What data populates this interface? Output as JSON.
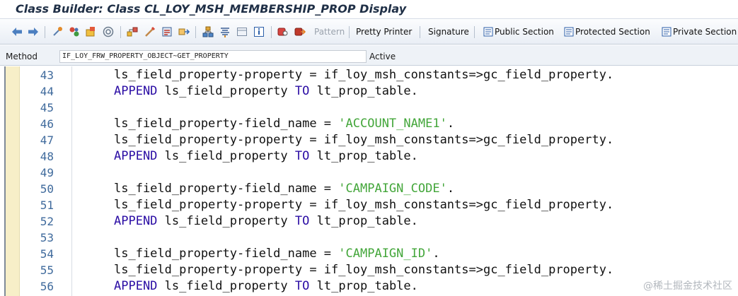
{
  "window": {
    "title": "Class Builder: Class CL_LOY_MSH_MEMBERSHIP_PROP Display"
  },
  "toolbar": {
    "icons": [
      "back-arrow-icon",
      "forward-arrow-icon",
      "other-object-icon",
      "display-change-icon",
      "active-inactive-icon",
      "activate-icon",
      "where-used-icon",
      "check-icon",
      "test-icon",
      "display-object-list-icon",
      "navigation-window-icon",
      "enhance-icon",
      "help-icon",
      "info-icon",
      "find-icon",
      "find-next-icon"
    ],
    "pattern_label": "Pattern",
    "pretty_printer_label": "Pretty Printer",
    "signature_label": "Signature",
    "public_section_label": "Public Section",
    "protected_section_label": "Protected Section",
    "private_section_label": "Private Section"
  },
  "method_bar": {
    "label": "Method",
    "value": "IF_LOY_FRW_PROPERTY_OBJECT~GET_PROPERTY",
    "status": "Active"
  },
  "editor": {
    "lines": [
      {
        "number": "43",
        "tokens": [
          {
            "t": "ls_field_property-property = if_loy_msh_constants=>gc_field_property.",
            "c": "plain"
          }
        ]
      },
      {
        "number": "44",
        "tokens": [
          {
            "t": "APPEND",
            "c": "kw"
          },
          {
            "t": " ls_field_property ",
            "c": "plain"
          },
          {
            "t": "TO",
            "c": "kw"
          },
          {
            "t": " lt_prop_table.",
            "c": "plain"
          }
        ]
      },
      {
        "number": "45",
        "tokens": []
      },
      {
        "number": "46",
        "tokens": [
          {
            "t": "ls_field_property-field_name = ",
            "c": "plain"
          },
          {
            "t": "'ACCOUNT_NAME1'",
            "c": "str"
          },
          {
            "t": ".",
            "c": "plain"
          }
        ]
      },
      {
        "number": "47",
        "tokens": [
          {
            "t": "ls_field_property-property = if_loy_msh_constants=>gc_field_property.",
            "c": "plain"
          }
        ]
      },
      {
        "number": "48",
        "tokens": [
          {
            "t": "APPEND",
            "c": "kw"
          },
          {
            "t": " ls_field_property ",
            "c": "plain"
          },
          {
            "t": "TO",
            "c": "kw"
          },
          {
            "t": " lt_prop_table.",
            "c": "plain"
          }
        ]
      },
      {
        "number": "49",
        "tokens": []
      },
      {
        "number": "50",
        "tokens": [
          {
            "t": "ls_field_property-field_name = ",
            "c": "plain"
          },
          {
            "t": "'CAMPAIGN_CODE'",
            "c": "str"
          },
          {
            "t": ".",
            "c": "plain"
          }
        ]
      },
      {
        "number": "51",
        "tokens": [
          {
            "t": "ls_field_property-property = if_loy_msh_constants=>gc_field_property.",
            "c": "plain"
          }
        ]
      },
      {
        "number": "52",
        "tokens": [
          {
            "t": "APPEND",
            "c": "kw"
          },
          {
            "t": " ls_field_property ",
            "c": "plain"
          },
          {
            "t": "TO",
            "c": "kw"
          },
          {
            "t": " lt_prop_table.",
            "c": "plain"
          }
        ]
      },
      {
        "number": "53",
        "tokens": []
      },
      {
        "number": "54",
        "tokens": [
          {
            "t": "ls_field_property-field_name = ",
            "c": "plain"
          },
          {
            "t": "'CAMPAIGN_ID'",
            "c": "str"
          },
          {
            "t": ".",
            "c": "plain"
          }
        ]
      },
      {
        "number": "55",
        "tokens": [
          {
            "t": "ls_field_property-property = if_loy_msh_constants=>gc_field_property.",
            "c": "plain"
          }
        ]
      },
      {
        "number": "56",
        "tokens": [
          {
            "t": "APPEND",
            "c": "kw"
          },
          {
            "t": " ls_field_property ",
            "c": "plain"
          },
          {
            "t": "TO",
            "c": "kw"
          },
          {
            "t": " lt_prop_table.",
            "c": "plain"
          }
        ]
      }
    ]
  },
  "watermark": "@稀土掘金技术社区",
  "colors": {
    "keyword": "#2a0ca4",
    "string": "#43a63a",
    "line_number": "#3f6a9c",
    "margin": "#f7efc8"
  }
}
